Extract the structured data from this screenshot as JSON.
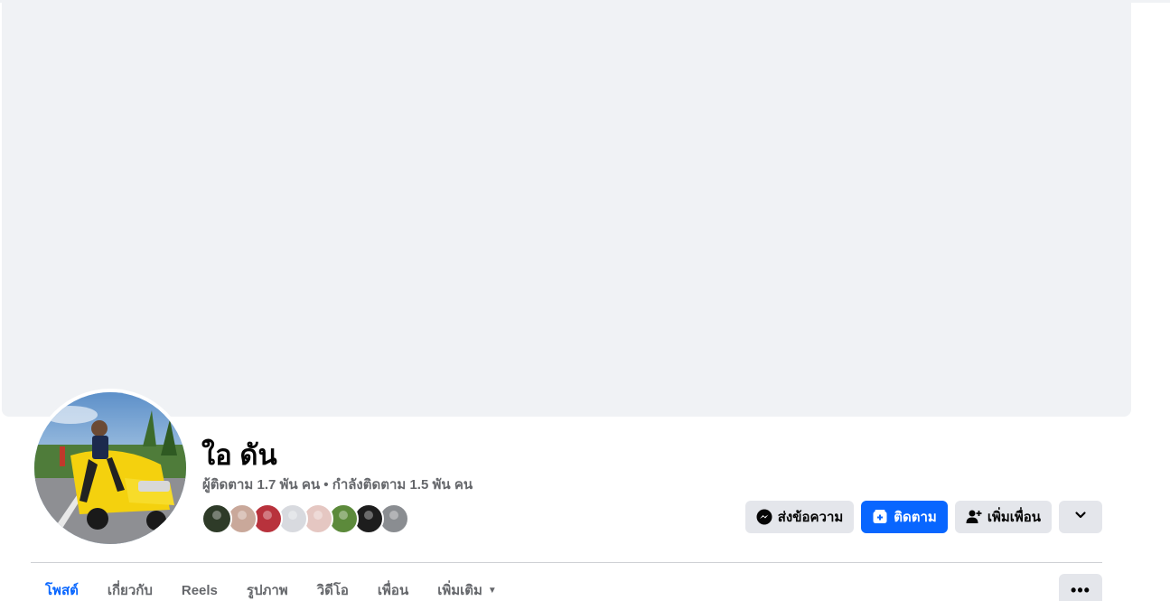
{
  "profile": {
    "name": "ใอ ดัน",
    "followers_label": "ผู้ติดตาม",
    "followers_count": "1.7 พัน",
    "people_unit": "คน",
    "separator": " • ",
    "following_label": "กำลังติดตาม",
    "following_count": "1.5 พัน"
  },
  "friend_avatars": [
    {
      "color": "#2e3b28"
    },
    {
      "color": "#c9a89a"
    },
    {
      "color": "#b8323c"
    },
    {
      "color": "#d8dadf"
    },
    {
      "color": "#e5c7c2"
    },
    {
      "color": "#5c8a3b"
    },
    {
      "color": "#1d1d1d"
    },
    {
      "color": "#8a8d91"
    }
  ],
  "actions": {
    "message_label": "ส่งข้อความ",
    "follow_label": "ติดตาม",
    "add_friend_label": "เพิ่มเพื่อน"
  },
  "tabs": [
    {
      "label": "โพสต์",
      "active": true
    },
    {
      "label": "เกี่ยวกับ"
    },
    {
      "label": "Reels"
    },
    {
      "label": "รูปภาพ"
    },
    {
      "label": "วิดีโอ"
    },
    {
      "label": "เพื่อน"
    },
    {
      "label": "เพิ่มเติม"
    }
  ],
  "more_menu_label": "•••",
  "colors": {
    "accent": "#0866ff",
    "cover_bg": "#f0f2f5",
    "button_gray": "#e4e6eb",
    "secondary_text": "#65676b"
  }
}
